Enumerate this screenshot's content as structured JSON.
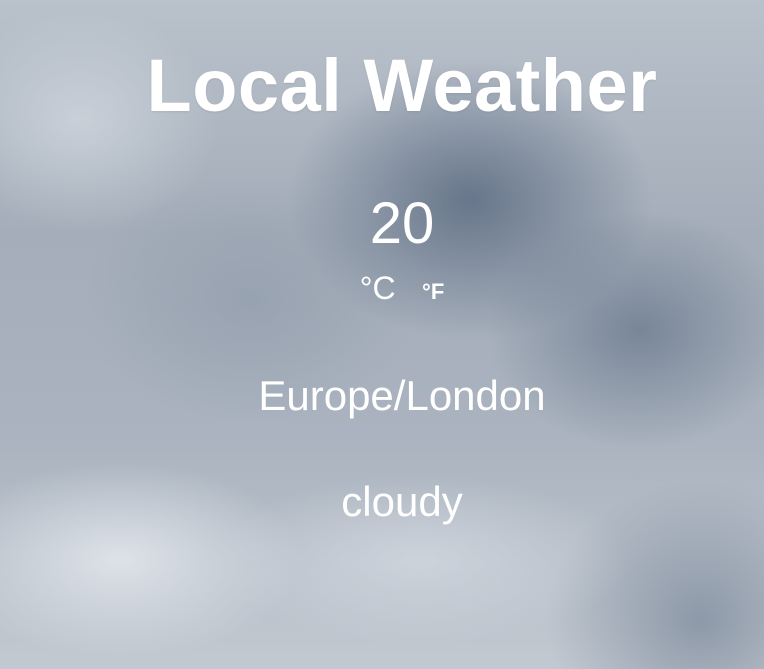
{
  "app": {
    "title": "Local Weather"
  },
  "weather": {
    "temperature": "20",
    "unit_celsius": "°C",
    "unit_fahrenheit": "°F",
    "location": "Europe/London",
    "condition": "cloudy"
  },
  "background": {
    "scene": "cloudy-sky",
    "palette": [
      "#b9c1cb",
      "#5c6c82",
      "#e1e6ec"
    ]
  }
}
